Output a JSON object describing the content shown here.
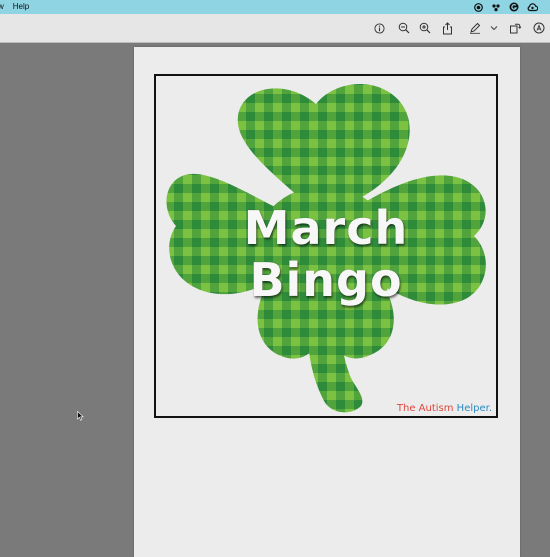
{
  "menubar": {
    "items": [
      "w",
      "Help"
    ],
    "status_icons": [
      "record-icon",
      "dropbox-icon",
      "grammarly-icon",
      "creative-cloud-icon"
    ]
  },
  "toolbar": {
    "buttons": [
      "info-icon",
      "zoom-out-icon",
      "zoom-in-icon",
      "share-icon",
      "markup-pen-icon",
      "chevron-down-icon",
      "rotate-icon",
      "annotate-icon"
    ]
  },
  "document": {
    "title_line1": "March",
    "title_line2": "Bingo",
    "brand_part1": "The Autism ",
    "brand_part2": "Helper."
  },
  "colors": {
    "menubar": "#8fd4e2",
    "toolbar": "#e6e6e6",
    "workspace": "#7a7a7a",
    "page": "#ececec",
    "shamrock_light": "#7cc242",
    "shamrock_dark": "#2e8b3a",
    "brand_red": "#e0463f",
    "brand_blue": "#2e8bc0"
  }
}
